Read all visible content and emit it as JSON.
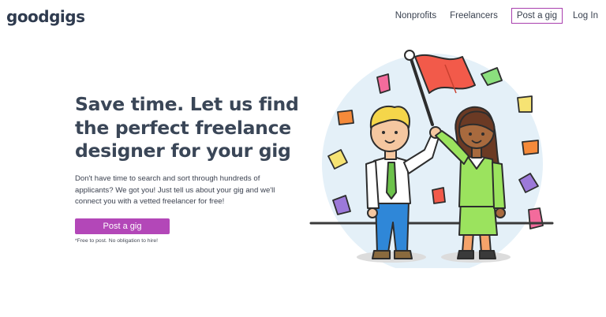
{
  "brand": {
    "logo_text": "goodgigs"
  },
  "nav": {
    "items": [
      {
        "label": "Nonprofits"
      },
      {
        "label": "Freelancers"
      },
      {
        "label": "Post a gig"
      },
      {
        "label": "Log In"
      }
    ]
  },
  "hero": {
    "title": "Save time. Let us find the perfect freelance designer for your gig",
    "description": "Don't have time to search and sort through hundreds of applicants? We got you! Just tell us about your gig and we'll connect you with a vetted freelancer for free!",
    "cta_label": "Post a gig",
    "fine_print": "*Free to post. No obligation to hire!"
  },
  "colors": {
    "accent": "#b347b8",
    "heading": "#3a4657",
    "flag": "#f25a4a",
    "backdrop_circle": "#e4f0f8"
  },
  "illustration": {
    "icon": "freelancers-celebrating-with-flag-illustration"
  }
}
